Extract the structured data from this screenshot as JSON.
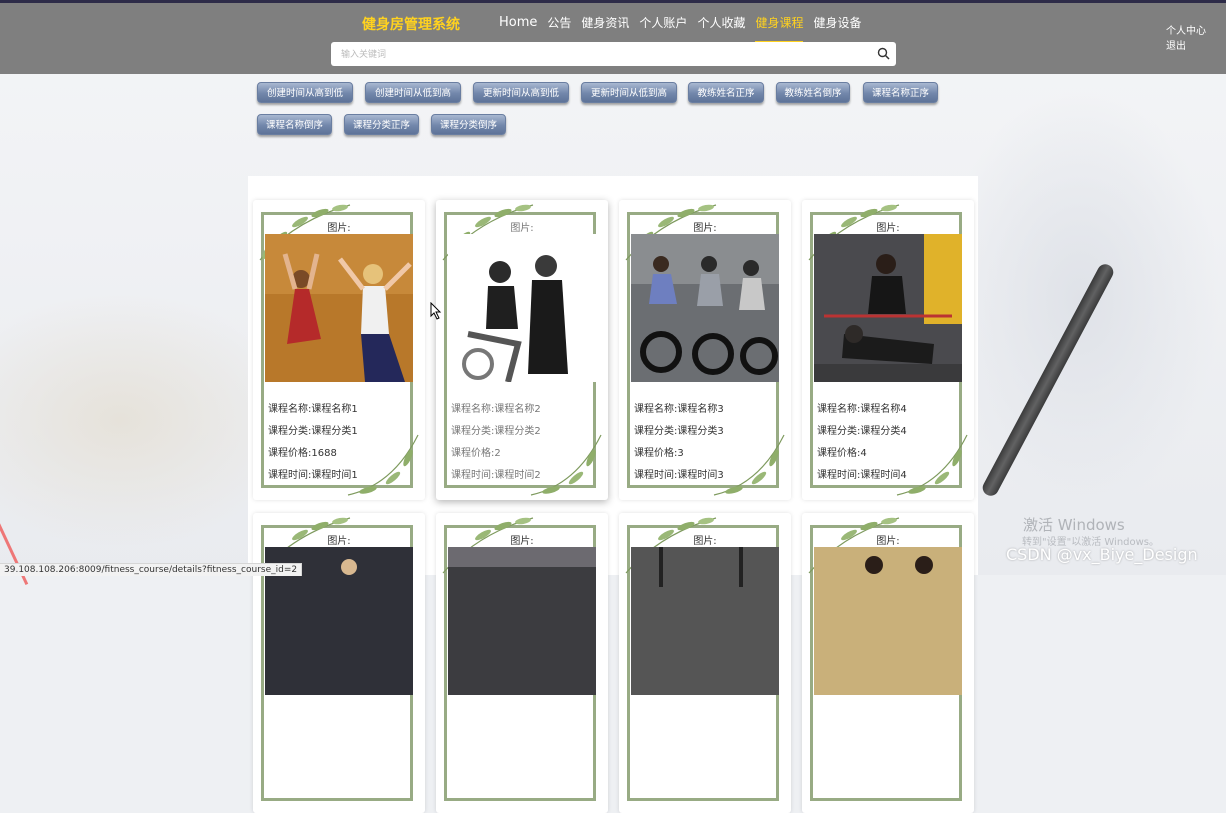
{
  "header": {
    "brand": "健身房管理系统",
    "nav": [
      {
        "label": "Home",
        "active": false
      },
      {
        "label": "公告",
        "active": false
      },
      {
        "label": "健身资讯",
        "active": false
      },
      {
        "label": "个人账户",
        "active": false
      },
      {
        "label": "个人收藏",
        "active": false
      },
      {
        "label": "健身课程",
        "active": true
      },
      {
        "label": "健身设备",
        "active": false
      }
    ],
    "user_center": "个人中心",
    "logout": "退出",
    "bg_color": "#7f7f7f",
    "accent_color": "#ffd21f"
  },
  "search": {
    "placeholder": "输入关键词",
    "value": ""
  },
  "sort_buttons": [
    "创建时间从高到低",
    "创建时间从低到高",
    "更新时间从高到低",
    "更新时间从低到高",
    "教练姓名正序",
    "教练姓名倒序",
    "课程名称正序",
    "课程名称倒序",
    "课程分类正序",
    "课程分类倒序"
  ],
  "courses": [
    {
      "pic_label": "图片:",
      "name": "课程名称:课程名称1",
      "category": "课程分类:课程分类1",
      "price": "课程价格:1688",
      "time": "课程时间:课程时间1"
    },
    {
      "pic_label": "图片:",
      "name": "课程名称:课程名称2",
      "category": "课程分类:课程分类2",
      "price": "课程价格:2",
      "time": "课程时间:课程时间2"
    },
    {
      "pic_label": "图片:",
      "name": "课程名称:课程名称3",
      "category": "课程分类:课程分类3",
      "price": "课程价格:3",
      "time": "课程时间:课程时间3"
    },
    {
      "pic_label": "图片:",
      "name": "课程名称:课程名称4",
      "category": "课程分类:课程分类4",
      "price": "课程价格:4",
      "time": "课程时间:课程时间4"
    },
    {
      "pic_label": "图片:"
    },
    {
      "pic_label": "图片:"
    },
    {
      "pic_label": "图片:"
    },
    {
      "pic_label": "图片:"
    }
  ],
  "status_url": "39.108.108.206:8009/fitness_course/details?fitness_course_id=2",
  "watermark": {
    "line1": "激活 Windows",
    "line2": "转到\"设置\"以激活 Windows。",
    "csdn": "CSDN @vx_Biye_Design"
  }
}
